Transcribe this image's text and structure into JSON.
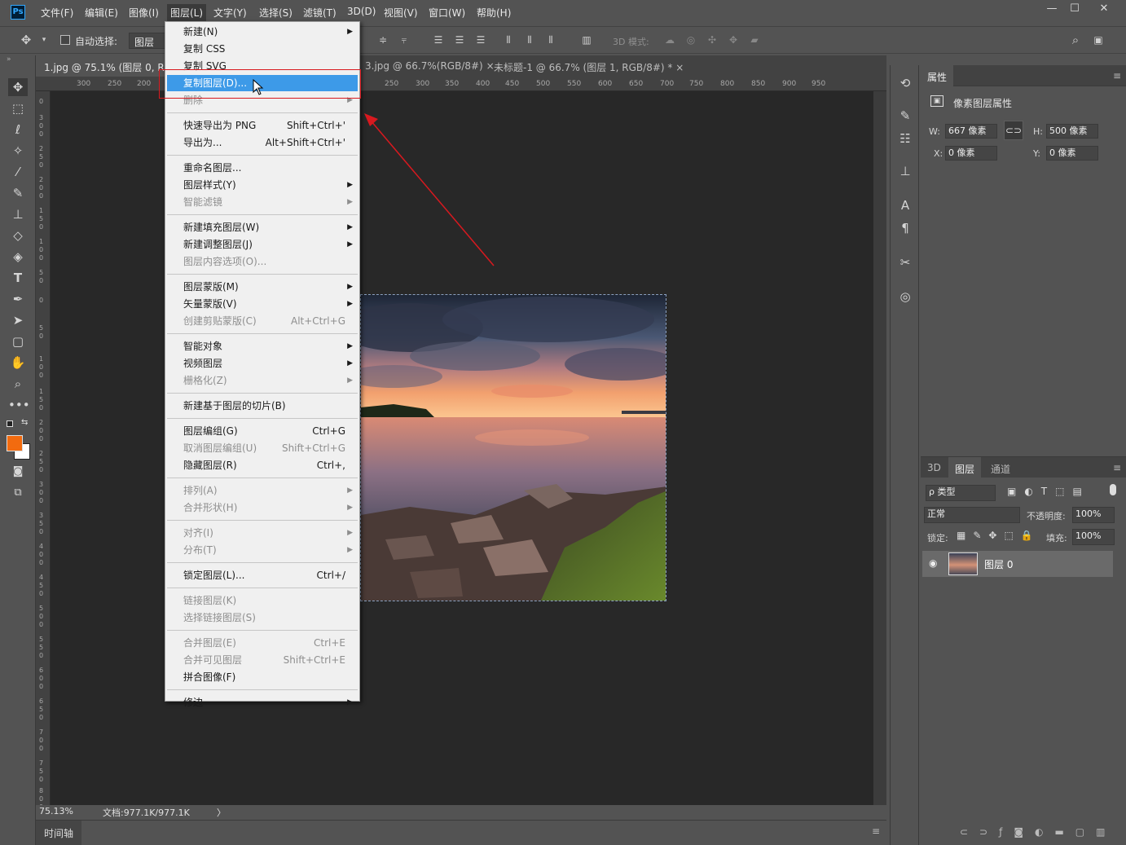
{
  "menubar": {
    "logo": "Ps",
    "items": [
      "文件(F)",
      "编辑(E)",
      "图像(I)",
      "图层(L)",
      "文字(Y)",
      "选择(S)",
      "滤镜(T)",
      "3D(D)",
      "视图(V)",
      "窗口(W)",
      "帮助(H)"
    ],
    "window_buttons": [
      "—",
      "☐",
      "✕"
    ]
  },
  "options": {
    "auto_select_label": "自动选择:",
    "auto_select_value": "图层",
    "mode3d_label": "3D 模式:"
  },
  "tabs": [
    {
      "label": "1.jpg @ 75.1% (图层 0, RGB",
      "active": true
    },
    {
      "label": "3.jpg @ 66.7%(RGB/8#)",
      "close": "×"
    },
    {
      "label": "未标题-1 @ 66.7% (图层 1, RGB/8#) *",
      "close": "×"
    }
  ],
  "ruler_top": [
    "300",
    "250",
    "200",
    "200",
    "250",
    "300",
    "350",
    "400",
    "450",
    "500",
    "550",
    "600",
    "650",
    "700",
    "750",
    "800",
    "850",
    "900",
    "950"
  ],
  "ruler_left": [
    "0",
    "300",
    "250",
    "200",
    "150",
    "100",
    "50",
    "0",
    "50",
    "100",
    "150",
    "200",
    "250",
    "300",
    "350",
    "400",
    "450",
    "500",
    "550",
    "600",
    "650",
    "700",
    "750",
    "800"
  ],
  "status": {
    "zoom": "75.13%",
    "doc": "文档:977.1K/977.1K",
    "arrow": "〉"
  },
  "timeline": {
    "label": "时间轴"
  },
  "properties": {
    "tab": "属性",
    "title": "像素图层属性",
    "w_label": "W:",
    "w_value": "667 像素",
    "h_label": "H:",
    "h_value": "500 像素",
    "x_label": "X:",
    "x_value": "0 像素",
    "y_label": "Y:",
    "y_value": "0 像素"
  },
  "layers": {
    "tabs": [
      "3D",
      "图层",
      "通道"
    ],
    "filter": "ρ 类型",
    "blend": "正常",
    "opacity_label": "不透明度:",
    "opacity": "100%",
    "lock_label": "锁定:",
    "fill_label": "填充:",
    "fill": "100%",
    "layer_name": "图层 0"
  },
  "menu": {
    "groups": [
      [
        {
          "label": "新建(N)",
          "arrow": true
        },
        {
          "label": "复制 CSS"
        },
        {
          "label": "复制 SVG"
        },
        {
          "label": "复制图层(D)...",
          "highlight": true
        },
        {
          "label": "删除",
          "arrow": true,
          "disabled": true
        }
      ],
      [
        {
          "label": "快速导出为 PNG",
          "shortcut": "Shift+Ctrl+'"
        },
        {
          "label": "导出为...",
          "shortcut": "Alt+Shift+Ctrl+'"
        }
      ],
      [
        {
          "label": "重命名图层..."
        },
        {
          "label": "图层样式(Y)",
          "arrow": true
        },
        {
          "label": "智能滤镜",
          "arrow": true,
          "disabled": true
        }
      ],
      [
        {
          "label": "新建填充图层(W)",
          "arrow": true
        },
        {
          "label": "新建调整图层(J)",
          "arrow": true
        },
        {
          "label": "图层内容选项(O)...",
          "disabled": true
        }
      ],
      [
        {
          "label": "图层蒙版(M)",
          "arrow": true
        },
        {
          "label": "矢量蒙版(V)",
          "arrow": true
        },
        {
          "label": "创建剪贴蒙版(C)",
          "shortcut": "Alt+Ctrl+G",
          "disabled": true
        }
      ],
      [
        {
          "label": "智能对象",
          "arrow": true
        },
        {
          "label": "视频图层",
          "arrow": true
        },
        {
          "label": "栅格化(Z)",
          "arrow": true,
          "disabled": true
        }
      ],
      [
        {
          "label": "新建基于图层的切片(B)"
        }
      ],
      [
        {
          "label": "图层编组(G)",
          "shortcut": "Ctrl+G"
        },
        {
          "label": "取消图层编组(U)",
          "shortcut": "Shift+Ctrl+G",
          "disabled": true
        },
        {
          "label": "隐藏图层(R)",
          "shortcut": "Ctrl+,"
        }
      ],
      [
        {
          "label": "排列(A)",
          "arrow": true,
          "disabled": true
        },
        {
          "label": "合并形状(H)",
          "arrow": true,
          "disabled": true
        }
      ],
      [
        {
          "label": "对齐(I)",
          "arrow": true,
          "disabled": true
        },
        {
          "label": "分布(T)",
          "arrow": true,
          "disabled": true
        }
      ],
      [
        {
          "label": "锁定图层(L)...",
          "shortcut": "Ctrl+/"
        }
      ],
      [
        {
          "label": "链接图层(K)",
          "disabled": true
        },
        {
          "label": "选择链接图层(S)",
          "disabled": true
        }
      ],
      [
        {
          "label": "合并图层(E)",
          "shortcut": "Ctrl+E",
          "disabled": true
        },
        {
          "label": "合并可见图层",
          "shortcut": "Shift+Ctrl+E",
          "disabled": true
        },
        {
          "label": "拼合图像(F)"
        }
      ],
      [
        {
          "label": "修边",
          "arrow": true
        }
      ]
    ]
  },
  "colors": {
    "foreground": "#f26b0f",
    "background": "#ffffff",
    "highlight": "#3d9ae8",
    "annotation": "#d8191f"
  },
  "icons": [
    "move-icon",
    "marquee-icon",
    "lasso-icon",
    "magic-wand-icon",
    "eyedropper-icon",
    "brush-icon",
    "stamp-icon",
    "eraser-icon",
    "paint-bucket-icon",
    "type-icon",
    "pen-icon",
    "path-select-icon",
    "shape-icon",
    "hand-icon",
    "zoom-icon",
    "more-icon",
    "eye-icon",
    "mouse-cursor-icon",
    "arrow-annotation-icon"
  ]
}
